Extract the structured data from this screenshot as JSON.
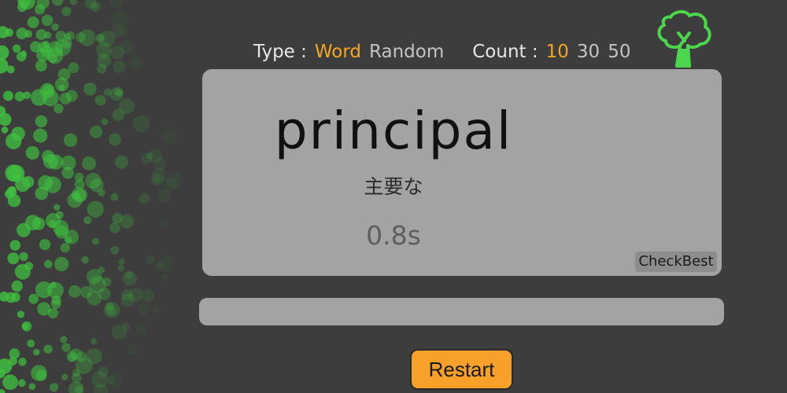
{
  "header": {
    "type_label": "Type :",
    "type_options": [
      "Word",
      "Random"
    ],
    "type_selected": "Word",
    "count_label": "Count :",
    "count_options": [
      "10",
      "30",
      "50"
    ],
    "count_selected": "10"
  },
  "card": {
    "word": "principal",
    "meaning": "主要な",
    "time": "0.8s",
    "check_best_label": "CheckBest"
  },
  "input": {
    "value": "",
    "placeholder": ""
  },
  "restart_label": "Restart",
  "colors": {
    "background": "#3d3d3d",
    "accent": "#f5a623",
    "card": "#a3a3a3",
    "dots": "#3fbf3f",
    "tree": "#4cd64c",
    "button": "#f7a12a"
  },
  "icons": {
    "logo": "tree-icon"
  }
}
